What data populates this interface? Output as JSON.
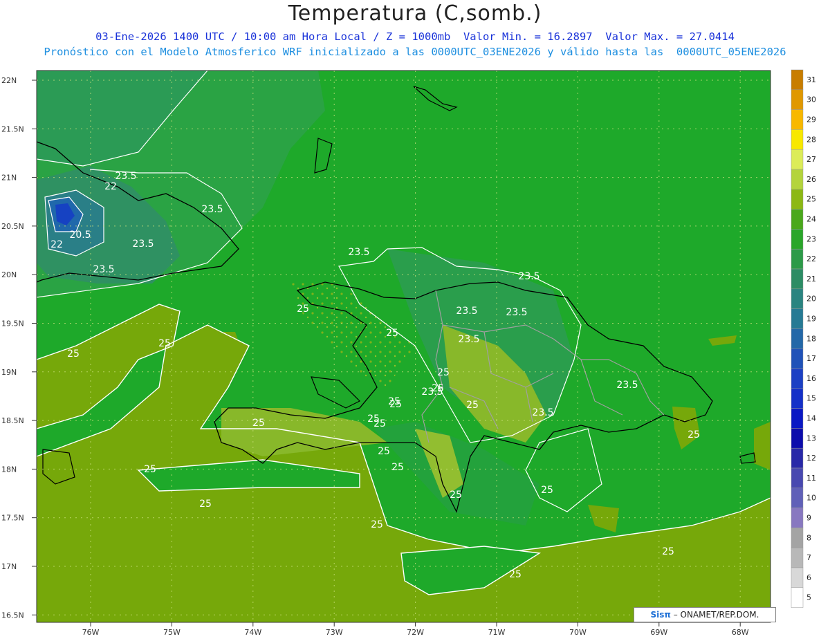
{
  "title": "Temperatura (C,somb.)",
  "subtitle_line1": "03-Ene-2026 1400 UTC / 10:00 am Hora Local / Z = 1000mb  Valor Min. = 16.2897  Valor Max. = 27.0414",
  "subtitle_line2": "Pronóstico con el Modelo Atmosferico WRF inicializado a las 0000UTC_03ENE2026 y válido hasta las  0000UTC_05ENE2026",
  "footer": {
    "brand": "Sisπ",
    "text": " – ONAMET/REP.DOM."
  },
  "lat_labels": [
    "22N",
    "21.5N",
    "21N",
    "20.5N",
    "20N",
    "19.5N",
    "19N",
    "18.5N",
    "18N",
    "17.5N",
    "17N",
    "16.5N"
  ],
  "lon_labels": [
    "76W",
    "75W",
    "74W",
    "73W",
    "72W",
    "71W",
    "70W",
    "69W",
    "68W"
  ],
  "colorbar": {
    "values": [
      "31",
      "30",
      "29",
      "28",
      "27",
      "26",
      "25",
      "24",
      "23",
      "22",
      "21",
      "20",
      "19",
      "18",
      "17",
      "16",
      "15",
      "14",
      "13",
      "12",
      "11",
      "10",
      "9",
      "8",
      "7",
      "6",
      "5"
    ],
    "colors": [
      "#c87d00",
      "#e09800",
      "#f8b800",
      "#f8e800",
      "#dcec58",
      "#b4d43c",
      "#8cb814",
      "#4aa81c",
      "#2aa62a",
      "#2c9a48",
      "#2c8c64",
      "#2a8480",
      "#267a94",
      "#2468a8",
      "#2052b8",
      "#1c40c4",
      "#1430c8",
      "#0a18c4",
      "#0c0cac",
      "#2828a8",
      "#4848b0",
      "#6060b8",
      "#8878c0",
      "#a4a4a4",
      "#b8b8b8",
      "#d8d8d8",
      "#ffffff"
    ]
  },
  "contour_labels": [
    "23.5",
    "22",
    "23.5",
    "20.5",
    "22",
    "23.5",
    "23.5",
    "23.5",
    "23.5",
    "25",
    "23.5",
    "23.5",
    "25",
    "25",
    "25",
    "23.5",
    "25",
    "23.5",
    "25",
    "25",
    "25",
    "23.5",
    "25",
    "25",
    "25",
    "25",
    "25",
    "25",
    "25",
    "25",
    "25",
    "25",
    "25",
    "23.5",
    "25",
    "25",
    "25"
  ],
  "colors": {
    "land_border": "#000000",
    "province_border": "#a0a0a0",
    "contour": "#ffffff",
    "ocean_base": "#1ea92a",
    "warm": "#7aa806"
  }
}
